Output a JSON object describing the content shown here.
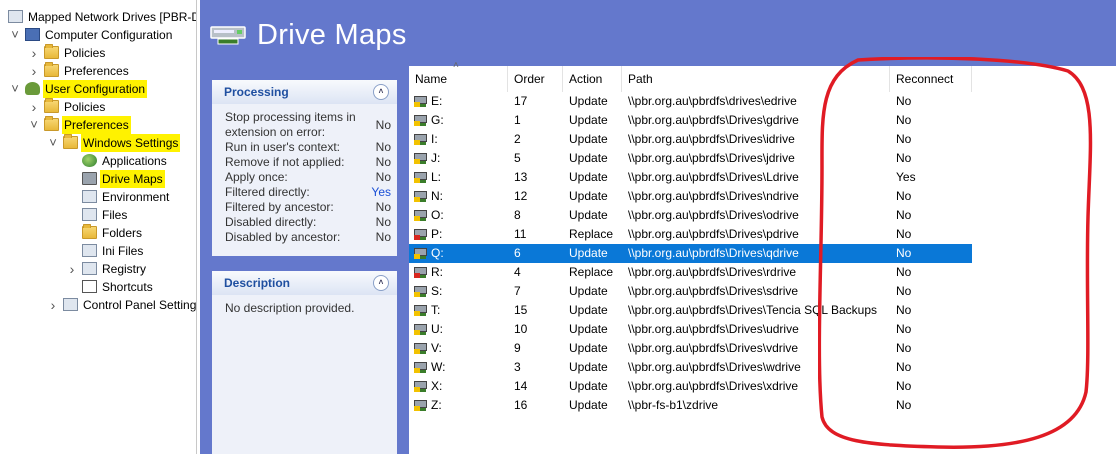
{
  "tree": {
    "nodes": [
      {
        "label": "Mapped Network Drives [PBR-D",
        "icon": "gpo-icon",
        "arrow": "",
        "indent": 0,
        "hl": false
      },
      {
        "label": "Computer Configuration",
        "icon": "monitor-icon",
        "arrow": "v",
        "indent": 1,
        "hl": false
      },
      {
        "label": "Policies",
        "icon": "folder-icon",
        "arrow": ">",
        "indent": 2,
        "hl": false
      },
      {
        "label": "Preferences",
        "icon": "folder-icon",
        "arrow": ">",
        "indent": 2,
        "hl": false
      },
      {
        "label": "User Configuration",
        "icon": "user-icon",
        "arrow": "v",
        "indent": 1,
        "hl": true
      },
      {
        "label": "Policies",
        "icon": "folder-icon",
        "arrow": ">",
        "indent": 2,
        "hl": false
      },
      {
        "label": "Preferences",
        "icon": "folder-icon",
        "arrow": "v",
        "indent": 2,
        "hl": true
      },
      {
        "label": "Windows Settings",
        "icon": "folder-icon",
        "arrow": "v",
        "indent": 3,
        "hl": true
      },
      {
        "label": "Applications",
        "icon": "globe-icon",
        "arrow": "",
        "indent": 4,
        "hl": false
      },
      {
        "label": "Drive Maps",
        "icon": "drive-icon",
        "arrow": "",
        "indent": 4,
        "hl": true
      },
      {
        "label": "Environment",
        "icon": "environment-icon",
        "arrow": "",
        "indent": 4,
        "hl": false
      },
      {
        "label": "Files",
        "icon": "files-icon",
        "arrow": "",
        "indent": 4,
        "hl": false
      },
      {
        "label": "Folders",
        "icon": "folder-icon",
        "arrow": "",
        "indent": 4,
        "hl": false
      },
      {
        "label": "Ini Files",
        "icon": "ini-icon",
        "arrow": "",
        "indent": 4,
        "hl": false
      },
      {
        "label": "Registry",
        "icon": "registry-icon",
        "arrow": ">",
        "indent": 4,
        "hl": false
      },
      {
        "label": "Shortcuts",
        "icon": "shortcut-icon",
        "arrow": "",
        "indent": 4,
        "hl": false
      },
      {
        "label": "Control Panel Settings",
        "icon": "control-panel-icon",
        "arrow": ">",
        "indent": 3,
        "hl": false
      }
    ]
  },
  "header": {
    "title": "Drive Maps"
  },
  "processing": {
    "title": "Processing",
    "rows": [
      {
        "label": "Stop processing items in extension on error:",
        "value": "No"
      },
      {
        "label": "Run in user's context:",
        "value": "No"
      },
      {
        "label": "Remove if not applied:",
        "value": "No"
      },
      {
        "label": "Apply once:",
        "value": "No"
      },
      {
        "label": "Filtered directly:",
        "value": "Yes"
      },
      {
        "label": "Filtered by ancestor:",
        "value": "No"
      },
      {
        "label": "Disabled directly:",
        "value": "No"
      },
      {
        "label": "Disabled by ancestor:",
        "value": "No"
      }
    ]
  },
  "description": {
    "title": "Description",
    "text": "No description provided."
  },
  "list": {
    "columns": [
      "Name",
      "Order",
      "Action",
      "Path",
      "Reconnect"
    ],
    "rows": [
      {
        "name": "E:",
        "order": "17",
        "action": "Update",
        "path": "\\\\pbr.org.au\\pbrdfs\\drives\\edrive",
        "reconnect": "No"
      },
      {
        "name": "G:",
        "order": "1",
        "action": "Update",
        "path": "\\\\pbr.org.au\\pbrdfs\\Drives\\gdrive",
        "reconnect": "No"
      },
      {
        "name": "I:",
        "order": "2",
        "action": "Update",
        "path": "\\\\pbr.org.au\\pbrdfs\\Drives\\idrive",
        "reconnect": "No"
      },
      {
        "name": "J:",
        "order": "5",
        "action": "Update",
        "path": "\\\\pbr.org.au\\pbrdfs\\Drives\\jdrive",
        "reconnect": "No"
      },
      {
        "name": "L:",
        "order": "13",
        "action": "Update",
        "path": "\\\\pbr.org.au\\pbrdfs\\Drives\\Ldrive",
        "reconnect": "Yes"
      },
      {
        "name": "N:",
        "order": "12",
        "action": "Update",
        "path": "\\\\pbr.org.au\\pbrdfs\\Drives\\ndrive",
        "reconnect": "No"
      },
      {
        "name": "O:",
        "order": "8",
        "action": "Update",
        "path": "\\\\pbr.org.au\\pbrdfs\\Drives\\odrive",
        "reconnect": "No"
      },
      {
        "name": "P:",
        "order": "11",
        "action": "Replace",
        "path": "\\\\pbr.org.au\\pbrdfs\\Drives\\pdrive",
        "reconnect": "No"
      },
      {
        "name": "Q:",
        "order": "6",
        "action": "Update",
        "path": "\\\\pbr.org.au\\pbrdfs\\Drives\\qdrive",
        "reconnect": "No"
      },
      {
        "name": "R:",
        "order": "4",
        "action": "Replace",
        "path": "\\\\pbr.org.au\\pbrdfs\\Drives\\rdrive",
        "reconnect": "No"
      },
      {
        "name": "S:",
        "order": "7",
        "action": "Update",
        "path": "\\\\pbr.org.au\\pbrdfs\\Drives\\sdrive",
        "reconnect": "No"
      },
      {
        "name": "T:",
        "order": "15",
        "action": "Update",
        "path": "\\\\pbr.org.au\\pbrdfs\\Drives\\Tencia SQL Backups",
        "reconnect": "No"
      },
      {
        "name": "U:",
        "order": "10",
        "action": "Update",
        "path": "\\\\pbr.org.au\\pbrdfs\\Drives\\udrive",
        "reconnect": "No"
      },
      {
        "name": "V:",
        "order": "9",
        "action": "Update",
        "path": "\\\\pbr.org.au\\pbrdfs\\Drives\\vdrive",
        "reconnect": "No"
      },
      {
        "name": "W:",
        "order": "3",
        "action": "Update",
        "path": "\\\\pbr.org.au\\pbrdfs\\Drives\\wdrive",
        "reconnect": "No"
      },
      {
        "name": "X:",
        "order": "14",
        "action": "Update",
        "path": "\\\\pbr.org.au\\pbrdfs\\Drives\\xdrive",
        "reconnect": "No"
      },
      {
        "name": "Z:",
        "order": "16",
        "action": "Update",
        "path": "\\\\pbr-fs-b1\\zdrive",
        "reconnect": "No"
      }
    ],
    "selected_index": 8
  },
  "colors": {
    "accent": "#6478cc",
    "selection": "#0a78d7",
    "highlight": "#fff200",
    "annotation": "#e01b24"
  }
}
